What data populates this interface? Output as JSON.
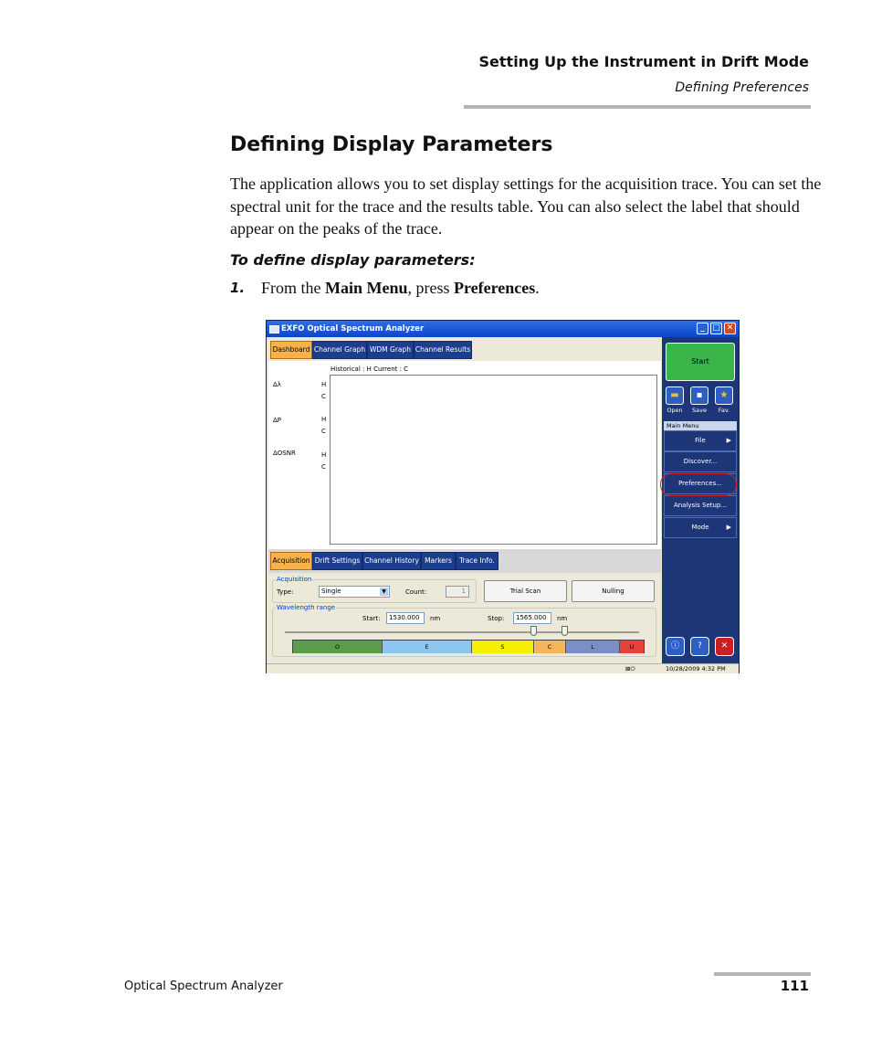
{
  "header": {
    "chapter_title": "Setting Up the Instrument in Drift Mode",
    "section_subtitle": "Defining Preferences"
  },
  "section": {
    "title": "Defining Display Parameters",
    "paragraph": "The application allows you to set display settings for the acquisition trace. You can set the spectral unit for the trace and the results table. You can also select the label that should appear on the peaks of the trace.",
    "procedure_title": "To define display parameters:",
    "step1_number": "1.",
    "step1_text_a": "From the ",
    "step1_bold_a": "Main Menu",
    "step1_text_b": ", press ",
    "step1_bold_b": "Preferences",
    "step1_text_c": "."
  },
  "footer": {
    "product": "Optical Spectrum Analyzer",
    "page_number": "111"
  },
  "screenshot": {
    "window_title": "EXFO Optical Spectrum Analyzer",
    "top_tabs": [
      "Dashboard",
      "Channel Graph",
      "WDM Graph",
      "Channel Results"
    ],
    "legend_text": "Historical : H      Current : C",
    "rows": [
      {
        "label": "Δλ",
        "h": "H",
        "c": "C"
      },
      {
        "label": "ΔP",
        "h": "H",
        "c": "C"
      },
      {
        "label": "ΔOSNR",
        "h": "H",
        "c": "C"
      }
    ],
    "start_label": "Start",
    "icon_labels": [
      "Open",
      "Save",
      "Fav."
    ],
    "main_menu_header": "Main Menu",
    "main_menu": [
      "File",
      "Discover...",
      "Preferences...",
      "Analysis Setup...",
      "Mode"
    ],
    "bottom_tabs": [
      "Acquisition",
      "Drift Settings",
      "Channel History",
      "Markers",
      "Trace Info."
    ],
    "acquisition_group": "Acquisition",
    "type_label": "Type:",
    "type_value": "Single",
    "count_label": "Count:",
    "count_value": "1",
    "trial_scan": "Trial Scan",
    "nulling": "Nulling",
    "wavelength_group": "Wavelength range",
    "start_field_label": "Start:",
    "start_value": "1530.000",
    "stop_field_label": "Stop:",
    "stop_value": "1565.000",
    "unit": "nm",
    "bands": [
      {
        "label": "O",
        "color": "#5c9c4a"
      },
      {
        "label": "E",
        "color": "#8cc6ee"
      },
      {
        "label": "S",
        "color": "#f4f000"
      },
      {
        "label": "C",
        "color": "#f5b55a"
      },
      {
        "label": "L",
        "color": "#7b8fc7"
      },
      {
        "label": "U",
        "color": "#e8413c"
      }
    ],
    "status_datetime": "10/28/2009 4:32 PM",
    "status_icons": "⊠⏻"
  }
}
